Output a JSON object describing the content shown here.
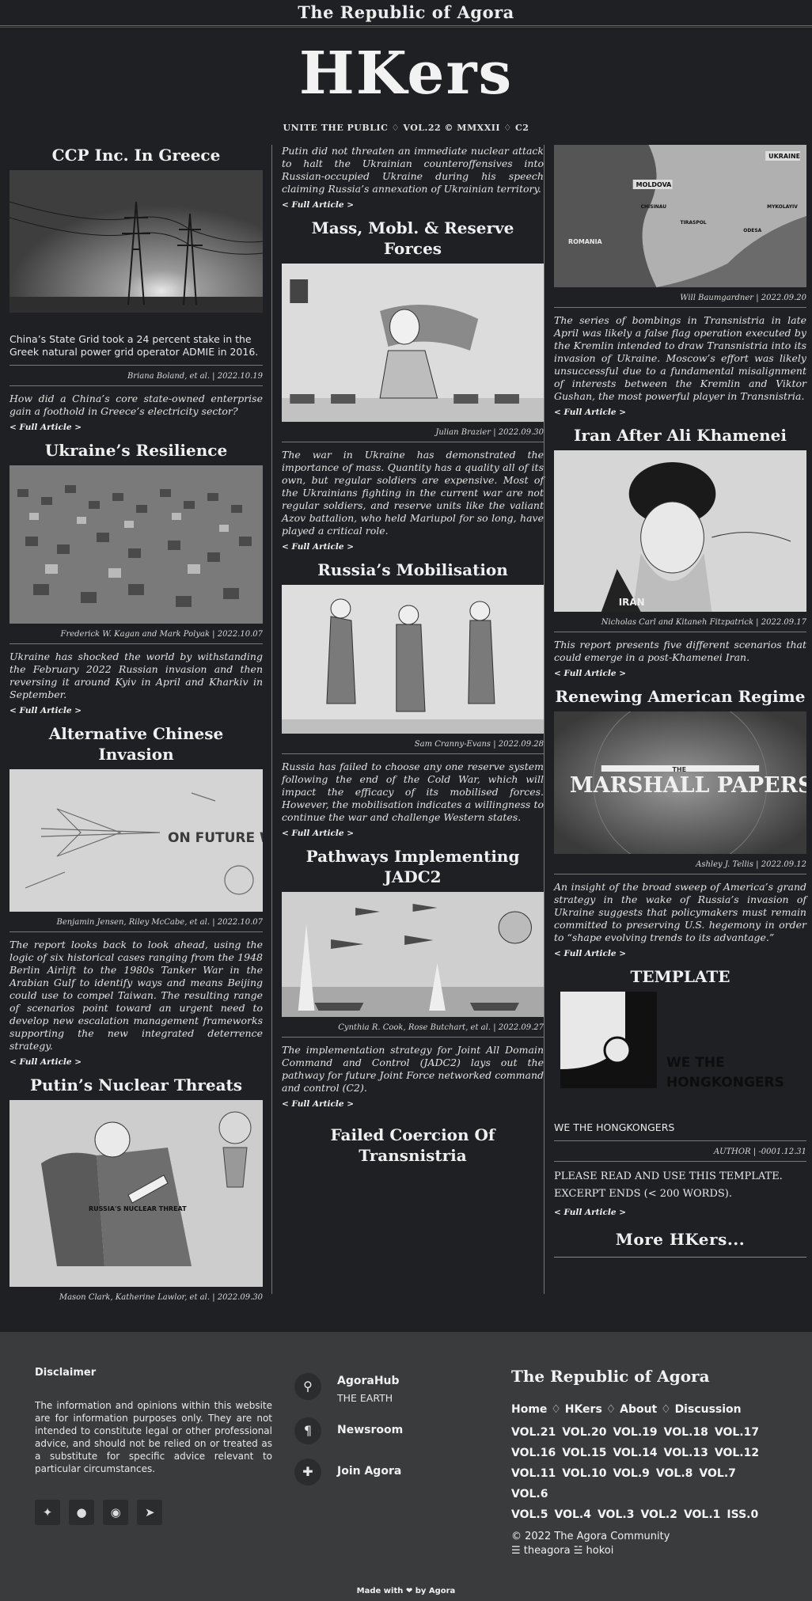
{
  "top_title": "The Republic of Agora",
  "masthead": "HKers",
  "subline": "UNITE THE PUBLIC ♢ VOL.22 © MMXXII ♢ C2",
  "full_label": "< Full Article >",
  "columns": {
    "c1": [
      {
        "title": "CCP Inc. In Greece",
        "plain": "China’s State Grid took a 24 percent stake in the Greek natural power grid operator ADMIE in 2016.",
        "byline": "Briana Boland, et al. | 2022.10.19",
        "abstract": "How did a China’s core state-owned enterprise gain a foothold in Greece’s electricity sector?"
      },
      {
        "title": "Ukraine’s Resilience",
        "byline": "Frederick W. Kagan and Mark Polyak | 2022.10.07",
        "abstract": "Ukraine has shocked the world by withstanding the February 2022 Russian invasion and then reversing it around Kyiv in April and Kharkiv in September."
      },
      {
        "title": "Alternative Chinese Invasion",
        "image_text": "ON FUTURE WAR",
        "byline": "Benjamin Jensen, Riley McCabe, et al. | 2022.10.07",
        "abstract": "The report looks back to look ahead, using the logic of six historical cases ranging from the 1948 Berlin Airlift to the 1980s Tanker War in the Arabian Gulf to identify ways and means Beijing could use to compel Taiwan. The resulting range of scenarios point toward an urgent need to develop new escalation management frameworks supporting the new integrated deterrence strategy."
      },
      {
        "title": "Putin’s Nuclear Threats",
        "image_text": "RUSSIA'S NUCLEAR THREAT",
        "byline": "Mason Clark, Katherine Lawlor, et al. | 2022.09.30"
      }
    ],
    "c2": [
      {
        "abstract": "Putin did not threaten an immediate nuclear attack to halt the Ukrainian counteroffensives into Russian-occupied Ukraine during his speech claiming Russia’s annexation of Ukrainian territory."
      },
      {
        "title": "Mass, Mobl. & Reserve Forces",
        "byline": "Julian Brazier | 2022.09.30",
        "abstract": "The war in Ukraine has demonstrated the importance of mass. Quantity has a quality all of its own, but regular soldiers are expensive. Most of the Ukrainians fighting in the current war are not regular soldiers, and reserve units like the valiant Azov battalion, who held Mariupol for so long, have played a critical role."
      },
      {
        "title": "Russia’s Mobilisation",
        "byline": "Sam Cranny-Evans | 2022.09.28",
        "abstract": "Russia has failed to choose any one reserve system following the end of the Cold War, which will impact the efficacy of its mobilised forces. However, the mobilisation indicates a willingness to continue the war and challenge Western states."
      },
      {
        "title": "Pathways Implementing JADC2",
        "byline": "Cynthia R. Cook, Rose Butchart, et al. | 2022.09.27",
        "abstract": "The implementation strategy for Joint All Domain Command and Control (JADC2) lays out the pathway for future Joint Force networked command and control (C2)."
      },
      {
        "title": "Failed Coercion Of Transnistria"
      }
    ],
    "c3": [
      {
        "map_labels": [
          "UKRAINE",
          "MOLDOVA",
          "ROMANIA",
          "CHISINAU",
          "TIRASPOL",
          "ODESA",
          "MYKOLAYIV"
        ],
        "byline": "Will Baumgardner | 2022.09.20",
        "abstract": "The series of bombings in Transnistria in late April was likely a false flag operation executed by the Kremlin intended to draw Transnistria into its invasion of Ukraine. Moscow’s effort was likely unsuccessful due to a fundamental misalignment of interests between the Kremlin and Viktor Gushan, the most powerful player in Transnistria."
      },
      {
        "title": "Iran After Ali Khamenei",
        "image_text": "IRAN",
        "byline": "Nicholas Carl and Kitaneh Fitzpatrick | 2022.09.17",
        "abstract": "This report presents five different scenarios that could emerge in a post-Khamenei Iran."
      },
      {
        "title": "Renewing American Regime",
        "image_text": "MARSHALL PAPERS",
        "image_small": "THE",
        "byline": "Ashley J. Tellis | 2022.09.12",
        "abstract": "An insight of the broad sweep of America’s grand strategy in the wake of Russia’s invasion of Ukraine suggests that policymakers must remain committed to preserving U.S. hegemony in order to “shape evolving trends to its advantage.”"
      },
      {
        "title": "TEMPLATE",
        "image_text_1": "WE THE",
        "image_text_2": "HONGKONGERS",
        "plain": "WE THE HONGKONGERS",
        "byline": "AUTHOR | -0001.12.31",
        "body_1": "PLEASE READ AND USE THIS TEMPLATE.",
        "body_2": "EXCERPT ENDS (< 200 WORDS)."
      }
    ],
    "more": "More HKers..."
  },
  "footer": {
    "disclaimer_title": "Disclaimer",
    "disclaimer_text": "The information and opinions within this website are for information purposes only. They are not intended to constitute legal or other professional advice, and should not be relied on or treated as a substitute for specific advice relevant to particular circumstances.",
    "social": [
      "twitter-icon",
      "github-icon",
      "reddit-icon",
      "telegram-icon"
    ],
    "contact": [
      {
        "label": "AgoraHub",
        "sub": "THE EARTH",
        "icon": "location-pin-icon"
      },
      {
        "label": "Newsroom",
        "icon": "pilcrow-icon"
      },
      {
        "label": "Join Agora",
        "icon": "puzzle-icon"
      }
    ],
    "title": "The Republic of Agora",
    "nav": [
      "Home",
      "HKers",
      "About",
      "Discussion"
    ],
    "nav_sep": "♢",
    "vols": [
      "VOL.21",
      "VOL.20",
      "VOL.19",
      "VOL.18",
      "VOL.17",
      "VOL.16",
      "VOL.15",
      "VOL.14",
      "VOL.13",
      "VOL.12",
      "VOL.11",
      "VOL.10",
      "VOL.9",
      "VOL.8",
      "VOL.7",
      "VOL.6",
      "VOL.5",
      "VOL.4",
      "VOL.3",
      "VOL.2",
      "VOL.1",
      "ISS.0"
    ],
    "copyright": "© 2022 The Agora Community",
    "links": "☰ theagora ☱ hokoi",
    "made": "Made with ❤ by Agora"
  }
}
